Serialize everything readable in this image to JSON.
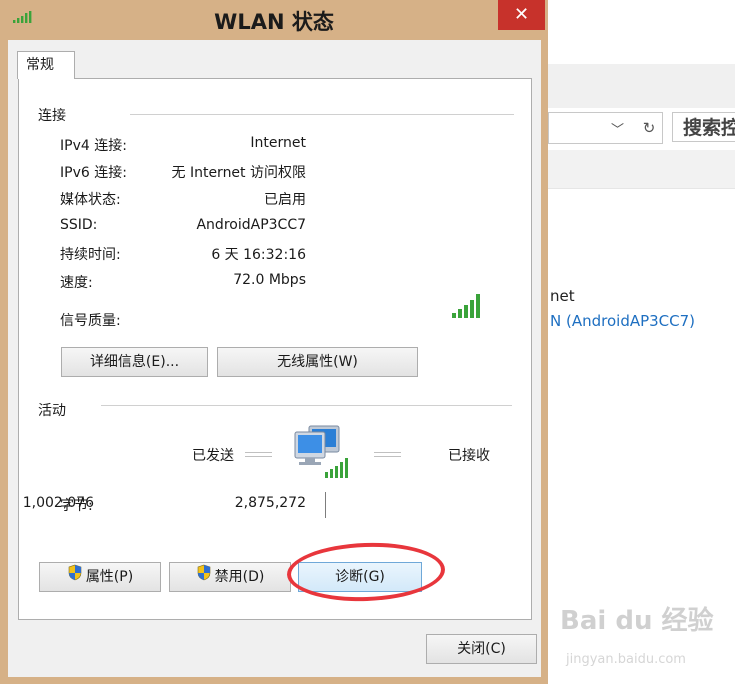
{
  "window": {
    "title": "WLAN 状态",
    "close_glyph": "✕"
  },
  "tab": {
    "label": "常规"
  },
  "connection": {
    "section_title": "连接",
    "rows": [
      {
        "label": "IPv4 连接:",
        "value": "Internet"
      },
      {
        "label": "IPv6 连接:",
        "value": "无 Internet 访问权限"
      },
      {
        "label": "媒体状态:",
        "value": "已启用"
      },
      {
        "label": "SSID:",
        "value": "AndroidAP3CC7"
      },
      {
        "label": "持续时间:",
        "value": "6 天 16:32:16"
      },
      {
        "label": "速度:",
        "value": "72.0 Mbps"
      }
    ],
    "signal_label": "信号质量:",
    "signal_bars": 5,
    "signal_max": 5
  },
  "buttons_top": {
    "details": "详细信息(E)...",
    "wireless": "无线属性(W)"
  },
  "activity": {
    "section_title": "活动",
    "sent_label": "已发送",
    "received_label": "已接收",
    "bytes_label": "字节:",
    "bytes_sent": "1,002,076",
    "bytes_received": "2,875,272"
  },
  "buttons_bottom": {
    "properties": "属性(P)",
    "disable": "禁用(D)",
    "diagnose": "诊断(G)"
  },
  "close_button": "关闭(C)",
  "background_window": {
    "search_text": "搜索控",
    "net_text": "net",
    "net_link": "N (AndroidAP3CC7)"
  },
  "watermark": {
    "text": "Bai du 经验",
    "url": "jingyan.baidu.com"
  },
  "colors": {
    "title_bar": "#d6b187",
    "close_button": "#c7322b",
    "annotation_circle": "#e8363c",
    "signal": "#3aa33a",
    "link": "#1e6fc1"
  }
}
